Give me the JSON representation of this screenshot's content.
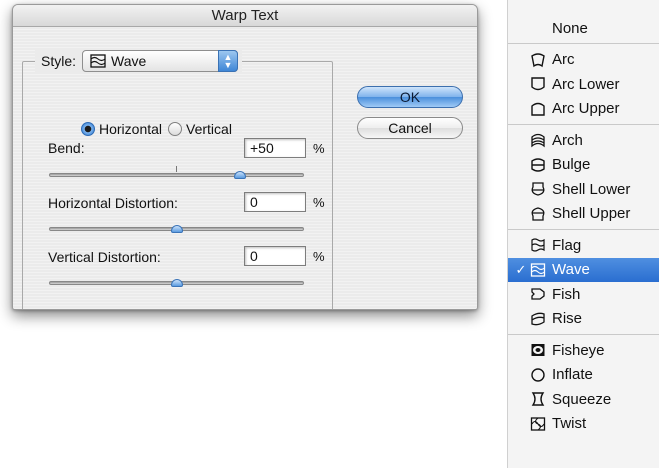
{
  "dialog": {
    "title": "Warp Text",
    "style_label": "Style:",
    "style_value": "Wave",
    "style_icon": "wave-icon",
    "orientation": {
      "selected": "Horizontal",
      "horizontal_label": "Horizontal",
      "vertical_label": "Vertical"
    },
    "bend": {
      "label": "Bend:",
      "value": "+50",
      "unit": "%",
      "level": 50
    },
    "horizontal_distortion": {
      "label": "Horizontal Distortion:",
      "value": "0",
      "unit": "%",
      "level": 0
    },
    "vertical_distortion": {
      "label": "Vertical Distortion:",
      "value": "0",
      "unit": "%",
      "level": 0
    },
    "ok_label": "OK",
    "cancel_label": "Cancel",
    "accent_color": "#3e86d6"
  },
  "menu": {
    "items": [
      {
        "label": "None",
        "icon": ""
      },
      {
        "label": "Arc",
        "icon": "arc-icon"
      },
      {
        "label": "Arc Lower",
        "icon": "arc-lower-icon"
      },
      {
        "label": "Arc Upper",
        "icon": "arc-upper-icon"
      },
      {
        "label": "Arch",
        "icon": "arch-icon"
      },
      {
        "label": "Bulge",
        "icon": "bulge-icon"
      },
      {
        "label": "Shell Lower",
        "icon": "shell-lower-icon"
      },
      {
        "label": "Shell Upper",
        "icon": "shell-upper-icon"
      },
      {
        "label": "Flag",
        "icon": "flag-icon"
      },
      {
        "label": "Wave",
        "icon": "wave-icon",
        "selected": true
      },
      {
        "label": "Fish",
        "icon": "fish-icon"
      },
      {
        "label": "Rise",
        "icon": "rise-icon"
      },
      {
        "label": "Fisheye",
        "icon": "fisheye-icon"
      },
      {
        "label": "Inflate",
        "icon": "inflate-icon"
      },
      {
        "label": "Squeeze",
        "icon": "squeeze-icon"
      },
      {
        "label": "Twist",
        "icon": "twist-icon"
      }
    ],
    "check_mark": "✓",
    "selection_color": "#2a6ed0"
  }
}
